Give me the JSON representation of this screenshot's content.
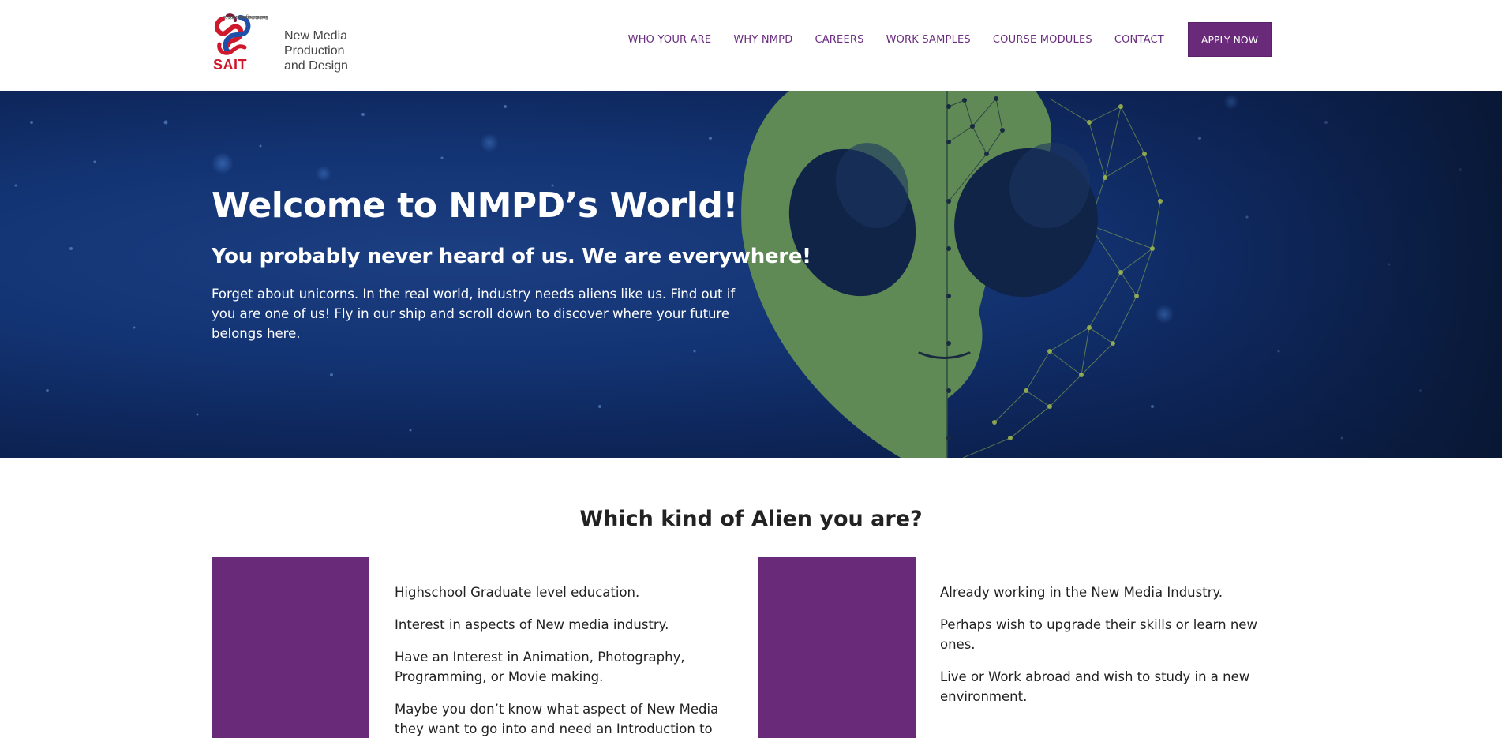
{
  "header": {
    "logo": {
      "brand": "SAIT",
      "school_lines": [
        "School of Information",
        "and Communications",
        "Technologies"
      ],
      "program_lines": [
        "New Media",
        "Production",
        "and Design"
      ]
    },
    "nav": [
      {
        "label": "WHO YOUR ARE"
      },
      {
        "label": "WHY NMPD"
      },
      {
        "label": "CAREERS"
      },
      {
        "label": "WORK SAMPLES"
      },
      {
        "label": "COURSE MODULES"
      },
      {
        "label": "CONTACT"
      }
    ],
    "apply_label": "APPLY NOW"
  },
  "hero": {
    "title": "Welcome to NMPD’s World!",
    "subtitle": "You probably never heard of us. We are everywhere!",
    "text": "Forget about unicorns. In the real world, industry needs aliens like us. Find out if you are one of us! Fly in our ship and scroll down to discover where your future belongs here."
  },
  "section": {
    "title": "Which kind of Alien you are?",
    "left_items": [
      "Highschool Graduate level education.",
      "Interest in aspects of New media industry.",
      "Have an Interest in Animation, Photography, Programming, or Movie making.",
      "Maybe you don’t know what aspect of New Media they want to go into and need an Introduction to"
    ],
    "right_items": [
      "Already working in the New Media Industry.",
      "Perhaps wish to upgrade their skills or learn new ones.",
      "Live or Work abroad and wish to study in a new environment."
    ]
  },
  "colors": {
    "brand_purple": "#6a2a7a",
    "nav_text": "#6a2c7f",
    "hero_blue": "#133474",
    "alien_green": "#5f8a55",
    "sait_red": "#d0182c"
  }
}
